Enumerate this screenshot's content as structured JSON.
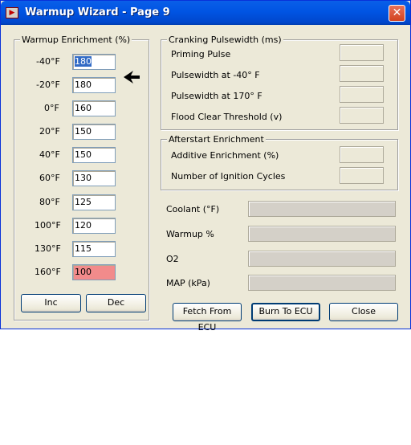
{
  "window": {
    "title": "Warmup Wizard - Page 9",
    "close_glyph": "✕"
  },
  "warmup": {
    "title": "Warmup Enrichment (%)",
    "rows": [
      {
        "label": "-40°F",
        "value": "180"
      },
      {
        "label": "-20°F",
        "value": "180"
      },
      {
        "label": "0°F",
        "value": "160"
      },
      {
        "label": "20°F",
        "value": "150"
      },
      {
        "label": "40°F",
        "value": "150"
      },
      {
        "label": "60°F",
        "value": "130"
      },
      {
        "label": "80°F",
        "value": "125"
      },
      {
        "label": "100°F",
        "value": "120"
      },
      {
        "label": "130°F",
        "value": "115"
      },
      {
        "label": "160°F",
        "value": "100"
      }
    ],
    "inc_label": "Inc",
    "dec_label": "Dec",
    "highlight_color": "#f28b8b",
    "selected_color": "#316ac5"
  },
  "cranking": {
    "title": "Cranking Pulsewidth (ms)",
    "fields": [
      "Priming Pulse",
      "Pulsewidth at -40° F",
      "Pulsewidth at  170° F",
      "Flood Clear Threshold (v)"
    ]
  },
  "afterstart": {
    "title": "Afterstart Enrichment",
    "fields": [
      "Additive Enrichment (%)",
      "Number of Ignition Cycles"
    ]
  },
  "gauges": [
    "Coolant (°F)",
    "Warmup %",
    "O2",
    "MAP (kPa)"
  ],
  "buttons": {
    "fetch": "Fetch From ECU",
    "burn": "Burn To ECU",
    "close": "Close"
  },
  "icons": {
    "app": "app-icon",
    "pointer": "pointer-arrow-icon"
  }
}
